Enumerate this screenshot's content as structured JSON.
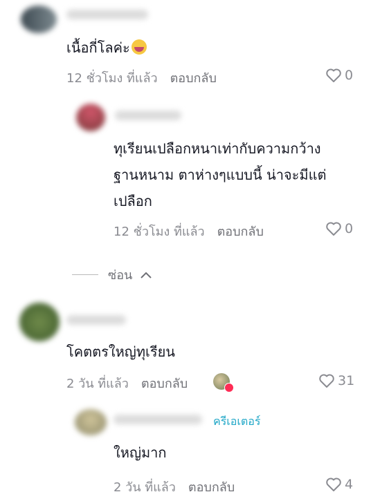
{
  "comments": [
    {
      "text": "เนื้อกี่โลค่ะ",
      "emoji": "rofl-emoji",
      "time": "12 ชั่วโมง ที่แล้ว",
      "reply": "ตอบกลับ",
      "likes": "0"
    },
    {
      "text_lines": [
        "ทุเรียนเปลือกหนาเท่ากับความกว้าง",
        "ฐานหนาม ตาห่างๆแบบนี้ น่าจะมีแต่",
        "เปลือก"
      ],
      "time": "12 ชั่วโมง ที่แล้ว",
      "reply": "ตอบกลับ",
      "likes": "0"
    },
    {
      "text": "โคตตรใหญ่ทุเรียน",
      "time": "2 วัน ที่แล้ว",
      "reply": "ตอบกลับ",
      "likes": "31"
    },
    {
      "badge": "ครีเอเตอร์",
      "text": "ใหญ่มาก",
      "time": "2 วัน ที่แล้ว",
      "reply": "ตอบกลับ",
      "likes": "4"
    }
  ],
  "hide_label": "ซ่อน",
  "colors": {
    "creator": "#20a7c7",
    "heart_badge": "#fe2c55"
  }
}
